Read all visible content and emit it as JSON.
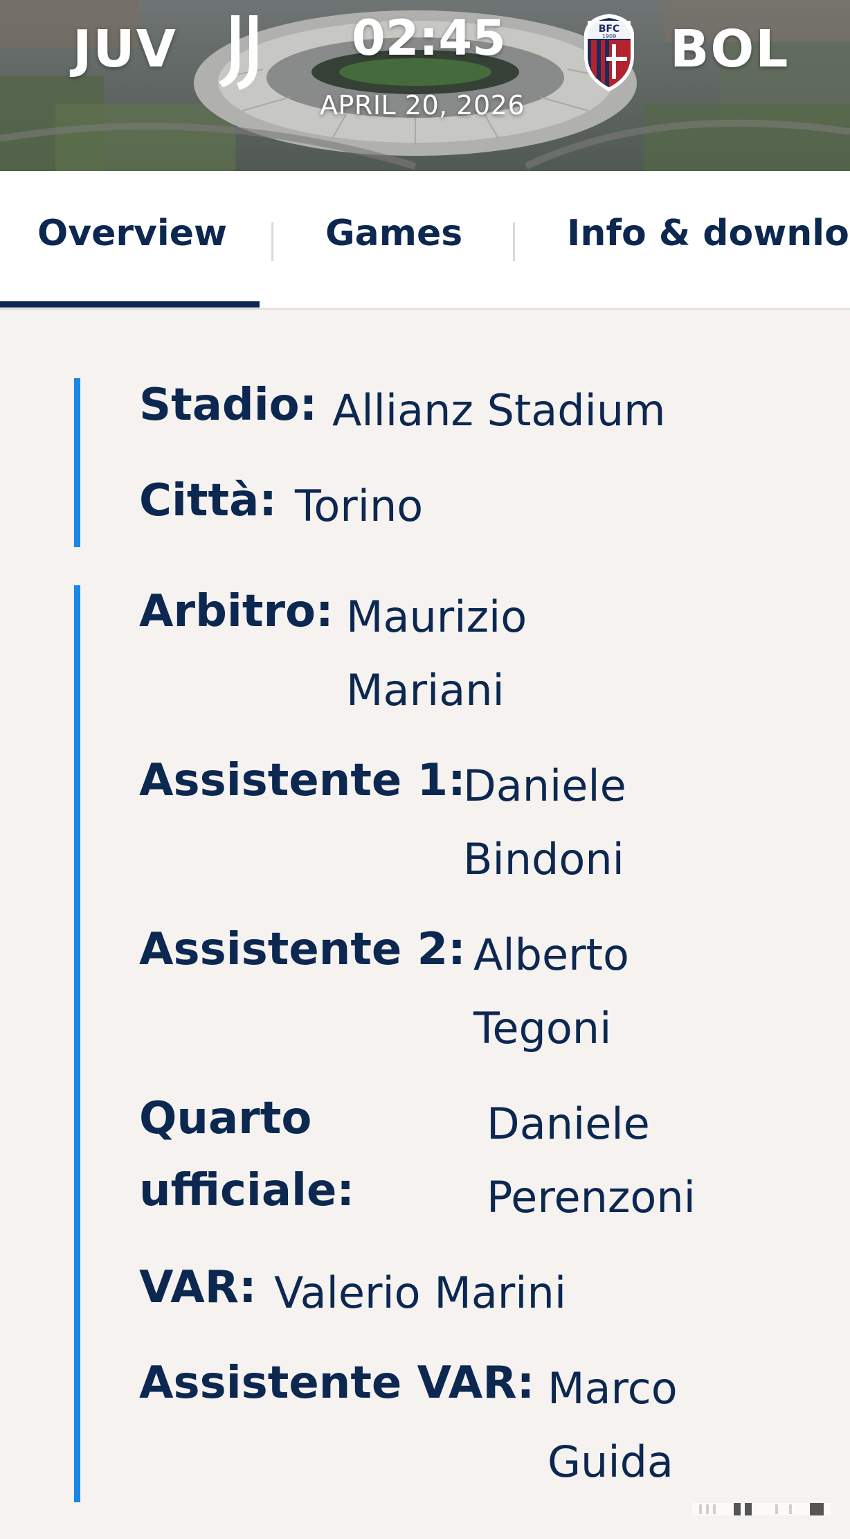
{
  "header": {
    "home_team": "JUV",
    "away_team": "BOL",
    "time": "02:45",
    "date": "APRIL 20, 2026",
    "away_badge_text": "BFC",
    "away_badge_year": "1909"
  },
  "tabs": [
    {
      "label": "Overview",
      "active": true
    },
    {
      "label": "Games",
      "active": false
    },
    {
      "label": "Info & downloa",
      "active": false
    }
  ],
  "venue": {
    "stadium_label": "Stadio:",
    "stadium_value": "Allianz Stadium",
    "city_label": "Città:",
    "city_value": "Torino"
  },
  "officials": {
    "referee_label": "Arbitro:",
    "referee_value_1": "Maurizio",
    "referee_value_2": "Mariani",
    "assistant1_label": "Assistente 1:",
    "assistant1_value_1": "Daniele",
    "assistant1_value_2": "Bindoni",
    "assistant2_label": "Assistente 2:",
    "assistant2_value_1": "Alberto",
    "assistant2_value_2": "Tegoni",
    "fourth_label_1": "Quarto",
    "fourth_label_2": "ufficiale:",
    "fourth_value_1": "Daniele",
    "fourth_value_2": "Perenzoni",
    "var_label": "VAR:",
    "var_value": "Valerio Marini",
    "avar_label": "Assistente VAR:",
    "avar_value_1": "Marco",
    "avar_value_2": "Guida"
  },
  "colors": {
    "navy": "#0c2750",
    "accent_blue": "#1a87e6",
    "background": "#f5f2f0"
  }
}
